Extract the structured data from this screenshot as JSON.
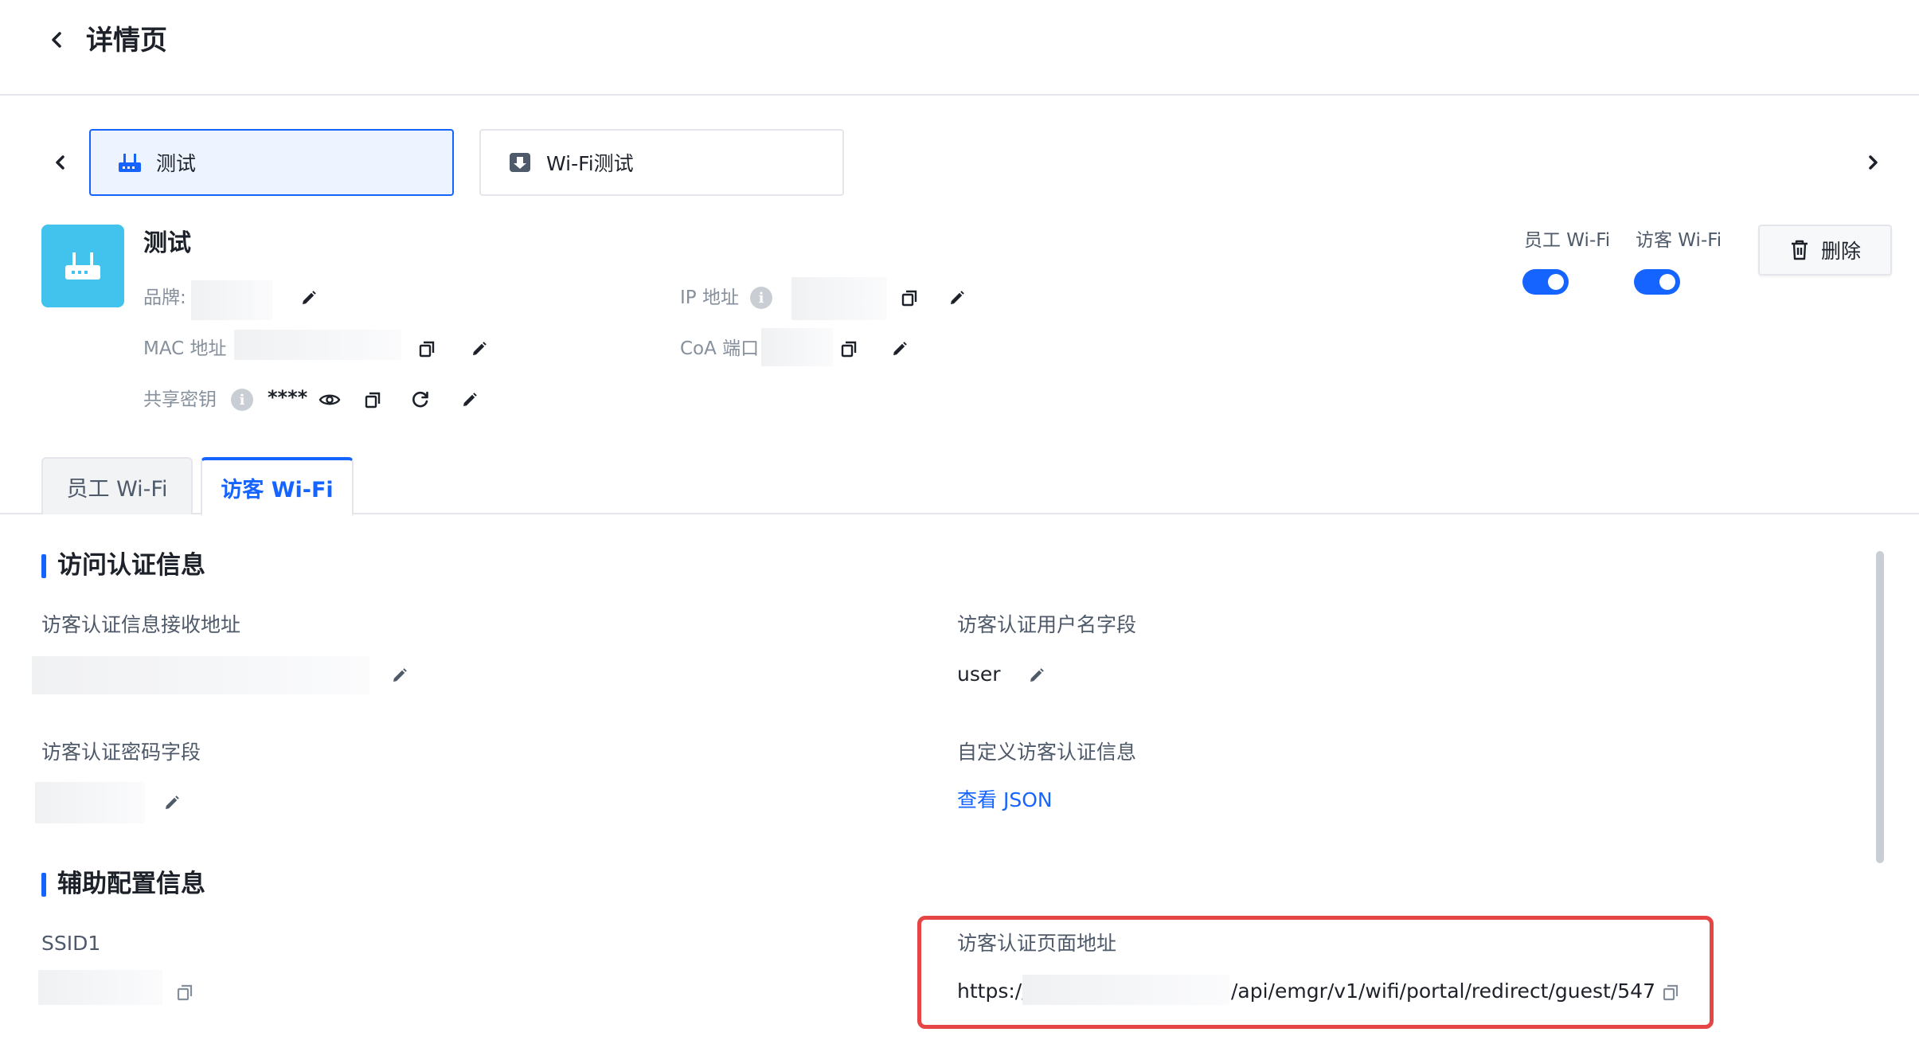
{
  "header": {
    "title": "详情页"
  },
  "device_tabs": [
    {
      "label": "测试",
      "icon": "router-icon"
    },
    {
      "label": "Wi-Fi测试",
      "icon": "device-icon"
    }
  ],
  "device": {
    "name": "测试",
    "brand_label": "品牌:",
    "ip_label": "IP 地址",
    "mac_label": "MAC 地址",
    "coa_label": "CoA 端口",
    "secret_label": "共享密钥",
    "secret_value": "****",
    "info_glyph": "i"
  },
  "toggles": {
    "staff_label": "员工 Wi-Fi",
    "staff_on": true,
    "guest_label": "访客 Wi-Fi",
    "guest_on": true
  },
  "actions": {
    "delete_label": "删除"
  },
  "wifi_tabs": {
    "staff": "员工 Wi-Fi",
    "guest": "访客 Wi-Fi",
    "active": "guest"
  },
  "auth_section": {
    "title": "访问认证信息",
    "receive_url_label": "访客认证信息接收地址",
    "username_field_label": "访客认证用户名字段",
    "username_field_value": "user",
    "password_field_label": "访客认证密码字段",
    "custom_info_label": "自定义访客认证信息",
    "custom_info_link": "查看 JSON"
  },
  "aux_section": {
    "title": "辅助配置信息",
    "ssid_label": "SSID1",
    "portal_url_label": "访客认证页面地址",
    "portal_url_prefix": "https://",
    "portal_url_suffix": "/api/emgr/v1/wifi/portal/redirect/guest/547"
  },
  "colors": {
    "accent": "#1664ff",
    "avatar": "#41c3ee",
    "highlight": "#e54545"
  }
}
